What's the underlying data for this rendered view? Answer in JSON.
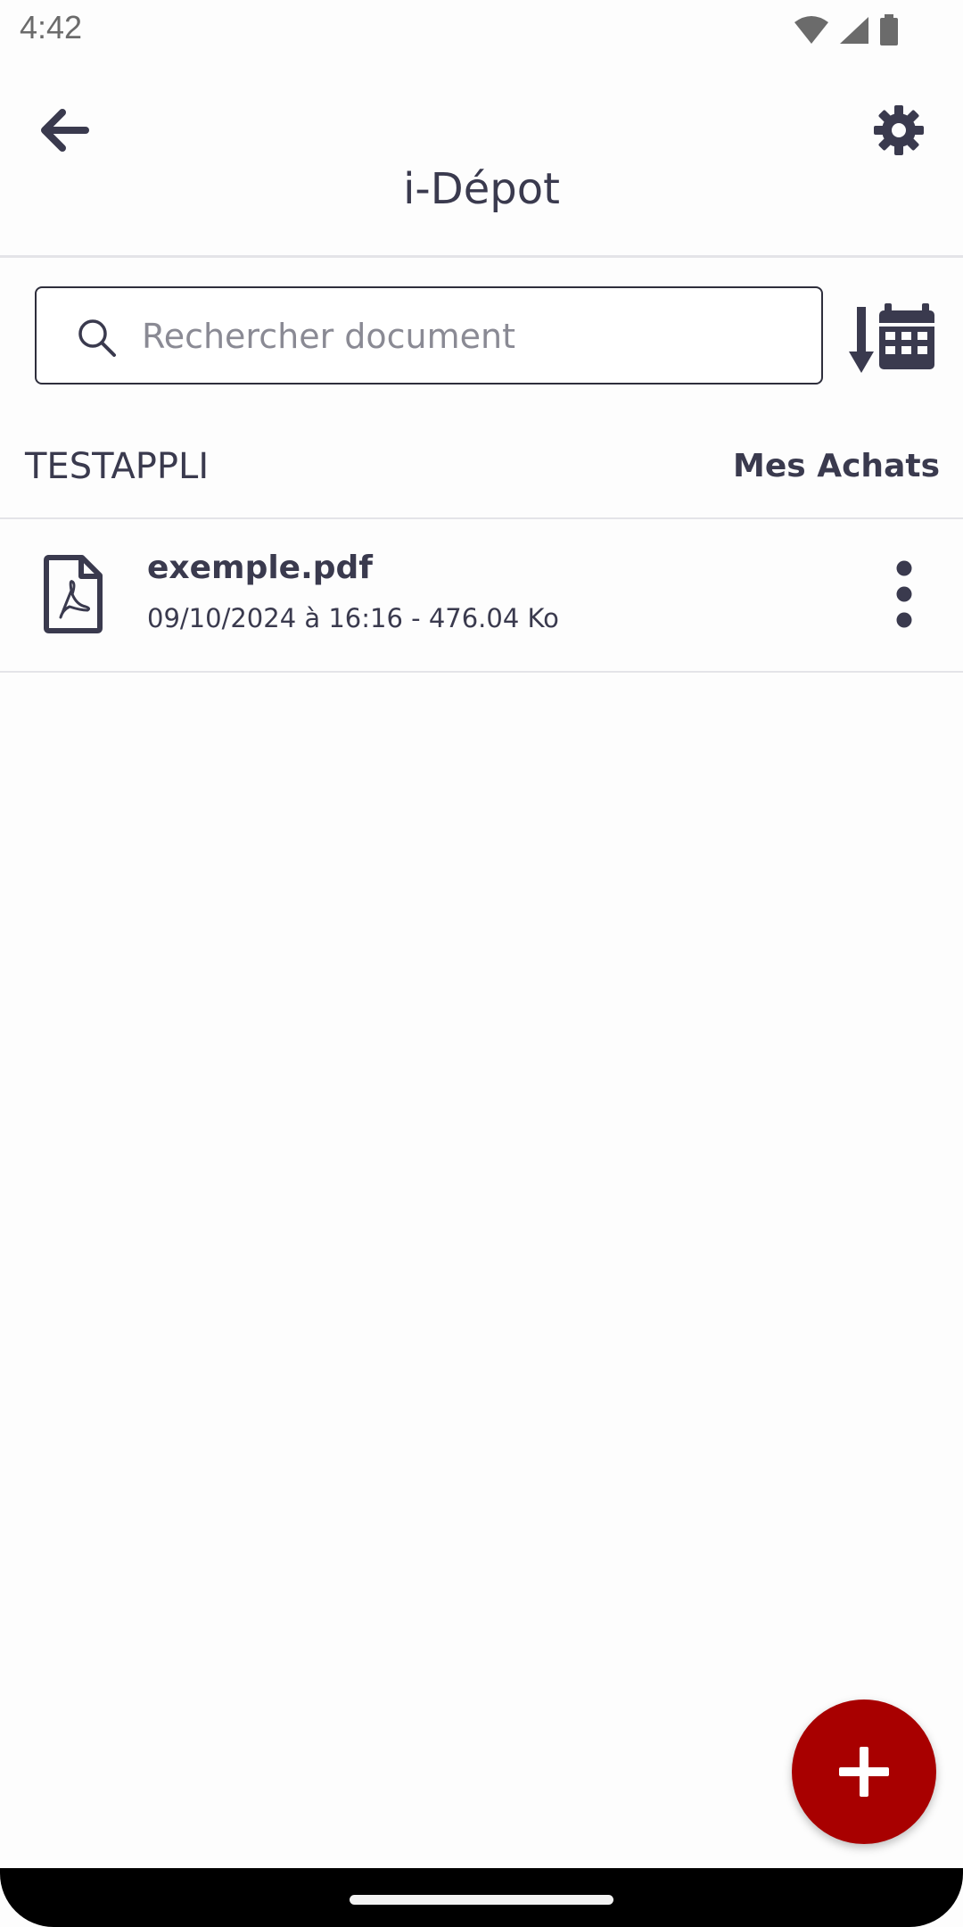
{
  "status_bar": {
    "time": "4:42"
  },
  "header": {
    "title": "i-Dépot",
    "back_icon": "arrow-left-icon",
    "settings_icon": "gear-icon"
  },
  "search": {
    "placeholder": "Rechercher document",
    "value": "",
    "sort_icon": "sort-by-date-icon"
  },
  "section": {
    "title": "TESTAPPLI",
    "link_label": "Mes Achats"
  },
  "files": [
    {
      "name": "exemple.pdf",
      "meta": "09/10/2024 à 16:16 - 476.04 Ko",
      "icon": "pdf-file-icon"
    }
  ],
  "fab": {
    "icon": "plus-icon"
  },
  "colors": {
    "text_primary": "#3a3a4e",
    "fab_background": "#a80000",
    "divider": "#e4e4e8",
    "background": "#fdfdfd"
  }
}
